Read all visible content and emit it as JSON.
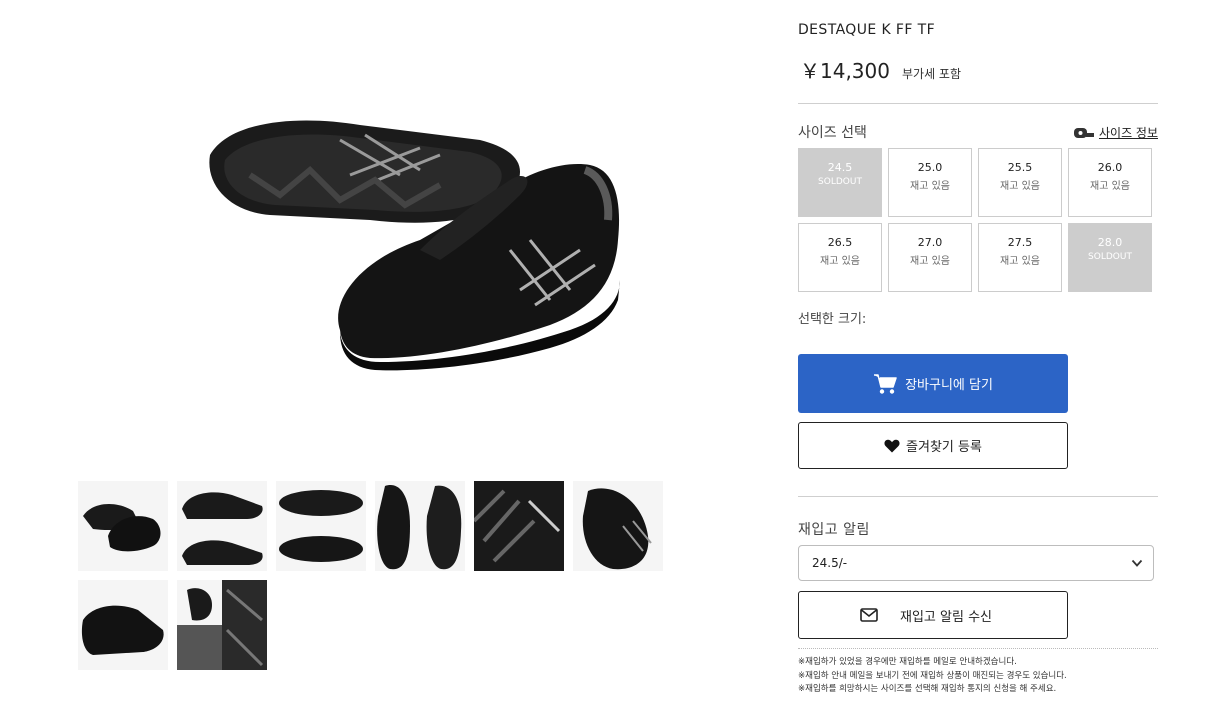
{
  "product": {
    "title": "DESTAQUE K FF TF",
    "price": "￥14,300",
    "tax_note": "부가세 포함"
  },
  "size_section": {
    "label": "사이즈 선택",
    "info_link": "사이즈 정보",
    "sizes": [
      {
        "size": "24.5",
        "status": "SOLDOUT",
        "soldout": true
      },
      {
        "size": "25.0",
        "status": "재고 있음",
        "soldout": false
      },
      {
        "size": "25.5",
        "status": "재고 있음",
        "soldout": false
      },
      {
        "size": "26.0",
        "status": "재고 있음",
        "soldout": false
      },
      {
        "size": "26.5",
        "status": "재고 있음",
        "soldout": false
      },
      {
        "size": "27.0",
        "status": "재고 있음",
        "soldout": false
      },
      {
        "size": "27.5",
        "status": "재고 있음",
        "soldout": false
      },
      {
        "size": "28.0",
        "status": "SOLDOUT",
        "soldout": true
      }
    ],
    "selected_label": "선택한 크기:"
  },
  "buttons": {
    "cart": "장바구니에 담기",
    "favorite": "즐겨찾기 등록",
    "restock_subscribe": "재입고 알림 수신"
  },
  "restock": {
    "label": "재입고 알림",
    "selected_option": "24.5/-"
  },
  "notes": [
    "※재입하가 있었을 경우에만 재입하를 메일로 안내하겠습니다.",
    "※재입하 안내 메일을 보내기 전에 재입하 상품이 매진되는 경우도 있습니다.",
    "※재입하를 희망하시는 사이즈를 선택해 재입하 통지의 신청을 해 주세요."
  ],
  "colors": {
    "accent": "#2c64c6",
    "soldout_bg": "#cdcdcd"
  }
}
